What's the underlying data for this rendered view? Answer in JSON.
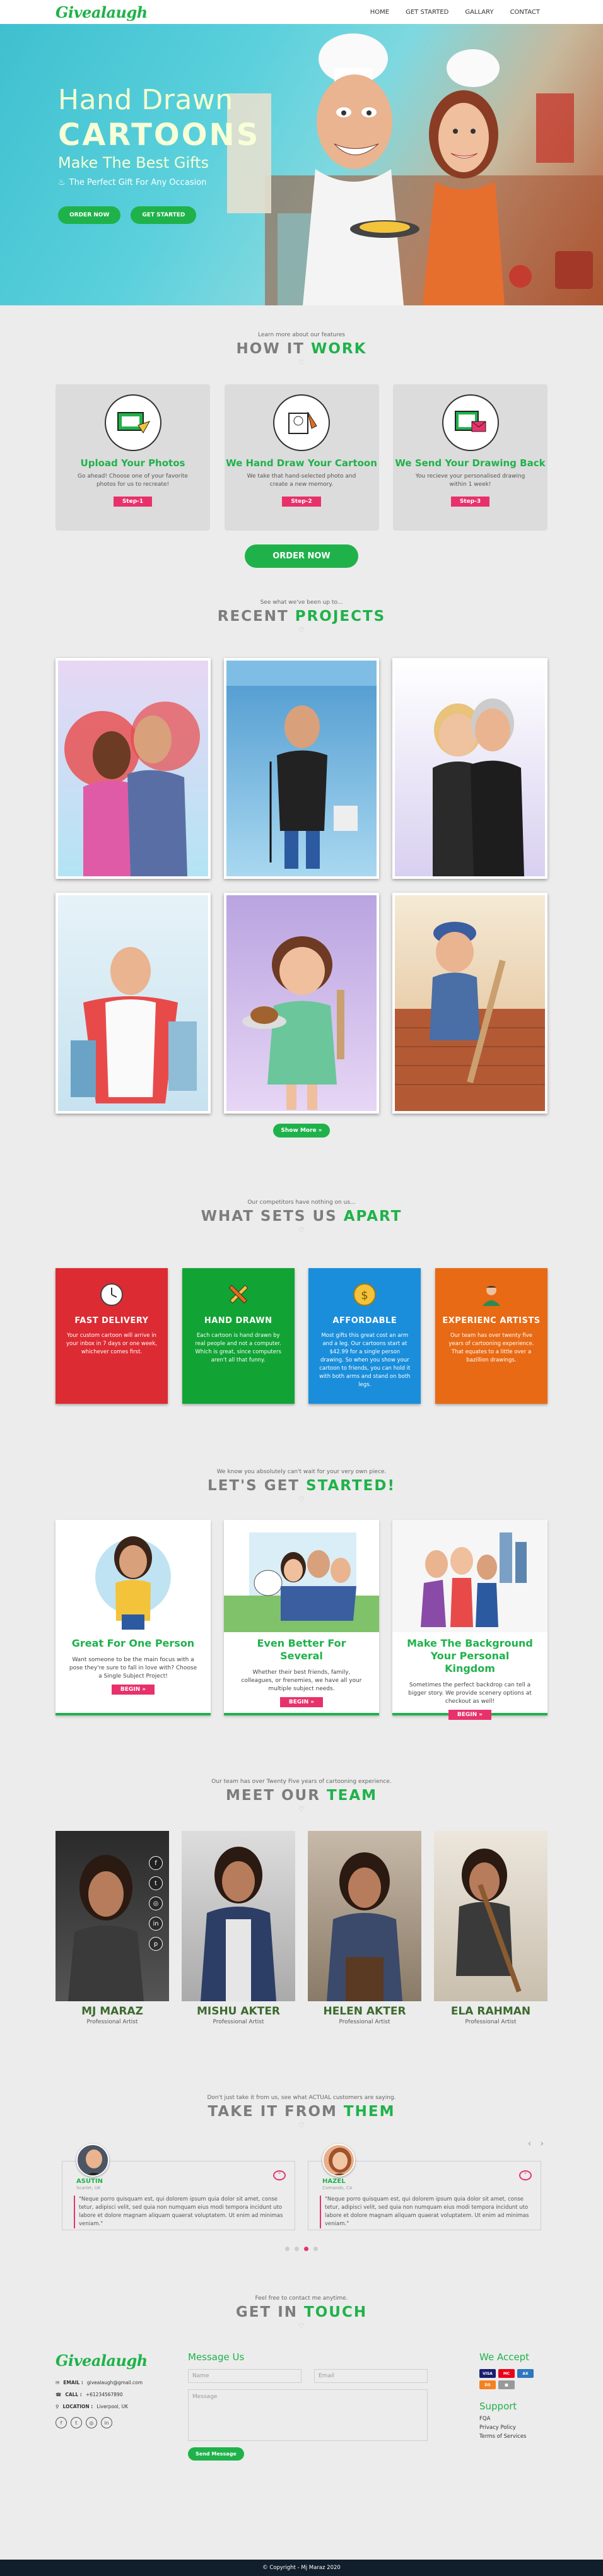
{
  "header": {
    "logo": "Givealaugh",
    "nav": [
      "HOME",
      "GET STARTED",
      "GALLARY",
      "CONTACT"
    ]
  },
  "hero": {
    "line1": "Hand Drawn",
    "line2": "CARTOONS",
    "line3": "Make The Best Gifts",
    "line4": "The Perfect Gift For Any Occasion",
    "btn_order": "ORDER NOW",
    "btn_start": "GET STARTED"
  },
  "how": {
    "subtitle": "Learn more about our features",
    "title_a": "HOW IT",
    "title_b": "WORK",
    "cards": [
      {
        "title": "Upload Your Photos",
        "desc": "Go ahead! Choose one of your favorite photos for us to recreate!",
        "step": "Step-1",
        "icon": "upload-photo-icon"
      },
      {
        "title": "We Hand Draw Your Cartoon",
        "desc": "We take that hand-selected photo and create a new memory.",
        "step": "Step-2",
        "icon": "hand-draw-icon"
      },
      {
        "title": "We Send Your Drawing Back",
        "desc": "You recieve your personalised drawing within 1 week!",
        "step": "Step-3",
        "icon": "send-drawing-icon"
      }
    ],
    "order_btn": "ORDER NOW"
  },
  "projects": {
    "subtitle": "See what we've been up to...",
    "title_a": "RECENT",
    "title_b": "PROJECTS",
    "more_btn": "Show More »"
  },
  "apart": {
    "subtitle": "Our competitors have nothing on us...",
    "title_a": "WHAT SETS US",
    "title_b": "APART",
    "cards": [
      {
        "title": "FAST DELIVERY",
        "desc": "Your custom cartoon will arrive in your inbox in 7 days or one week, whichever comes first.",
        "color": "#dd2b33",
        "icon": "clock-icon"
      },
      {
        "title": "HAND DRAWN",
        "desc": "Each cartoon is hand drawn by real people and not a computer. Which is great, since computers aren't all that funny.",
        "color": "#12a335",
        "icon": "pencil-brush-icon"
      },
      {
        "title": "AFFORDABLE",
        "desc": "Most gifts this great cost an arm and a leg. Our cartoons start at $42.99 for a single person drawing. So when you show your cartoon to friends, you can hold it with both arms and stand on both legs.",
        "color": "#1a8edb",
        "icon": "coin-icon"
      },
      {
        "title": "EXPERIENC ARTISTS",
        "desc": "Our team has over twenty five years of cartooning experience. That equates to a little over a bazillion drawings.",
        "color": "#e86a14",
        "icon": "artist-icon"
      }
    ]
  },
  "started": {
    "subtitle": "We know you absolutely can't wait for your very own piece.",
    "title_a": "LET'S GET",
    "title_b": "STARTED!",
    "cards": [
      {
        "title": "Great For One Person",
        "desc": "Want someone to be the main focus with a pose they're sure to fall in love with? Choose a Single Subject Project!",
        "btn": "BEGIN »"
      },
      {
        "title": "Even Better For Several",
        "desc": "Whether their best friends, family, colleagues, or frenemies, we have all your multiple subject needs.",
        "btn": "BEGIN »"
      },
      {
        "title": "Make The Background Your Personal Kingdom",
        "desc": "Sometimes the perfect backdrop can tell a bigger story. We provide scenery options at checkout as well!",
        "btn": "BEGIN »"
      }
    ]
  },
  "team": {
    "subtitle": "Our team has over Twenty Five years of cartooning experience.",
    "title_a": "MEET OUR",
    "title_b": "TEAM",
    "members": [
      {
        "name": "MJ MARAZ",
        "role": "Professional Artist"
      },
      {
        "name": "MISHU AKTER",
        "role": "Professional Artist"
      },
      {
        "name": "HELEN AKTER",
        "role": "Professional Artist"
      },
      {
        "name": "ELA RAHMAN",
        "role": "Professional Artist"
      }
    ],
    "social_icons": [
      "facebook-icon",
      "twitter-icon",
      "instagram-icon",
      "linkedin-icon",
      "pinterest-icon"
    ]
  },
  "testimonials": {
    "subtitle": "Don't just take it from us, see what ACTUAL customers are saying.",
    "title_a": "TAKE IT FROM",
    "title_b": "THEM",
    "items": [
      {
        "name": "ASUTIN",
        "location": "Scarlet, UK",
        "text": "\"Neque porro quisquam est, qui dolorem ipsum quia dolor sit amet, conse tetur, adipisci velit, sed quia non numquam eius modi tempora incidunt uto labore et dolore magnam aliquam quaerat voluptatem. Ut enim ad minimas veniam.\""
      },
      {
        "name": "HAZEL",
        "location": "Comando, CA",
        "text": "\"Neque porro quisquam est, qui dolorem ipsum quia dolor sit amet, conse tetur, adipisci velit, sed quia non numquam eius modi tempora incidunt uto labore et dolore magnam aliquam quaerat voluptatem. Ut enim ad minimas veniam.\""
      }
    ]
  },
  "contact": {
    "subtitle": "Feel free to contact me anytime.",
    "title_a": "GET IN",
    "title_b": "TOUCH",
    "logo": "Givealaugh",
    "email_label": "EMAIL :",
    "email": "givealaugh@gmail.com",
    "call_label": "CALL :",
    "phone": "+61234567890",
    "location_label": "LOCATION :",
    "location": "Liverpool, UK",
    "message_title": "Message Us",
    "name_placeholder": "Name",
    "email_placeholder": "Email",
    "message_placeholder": "Message",
    "send_btn": "Send Message",
    "accept_title": "We Accept",
    "support_title": "Support",
    "support_links": [
      "FQA",
      "Privacy Policy",
      "Terms of Services"
    ]
  },
  "footer": {
    "copyright": "© Copyright - Mj Maraz 2020"
  }
}
